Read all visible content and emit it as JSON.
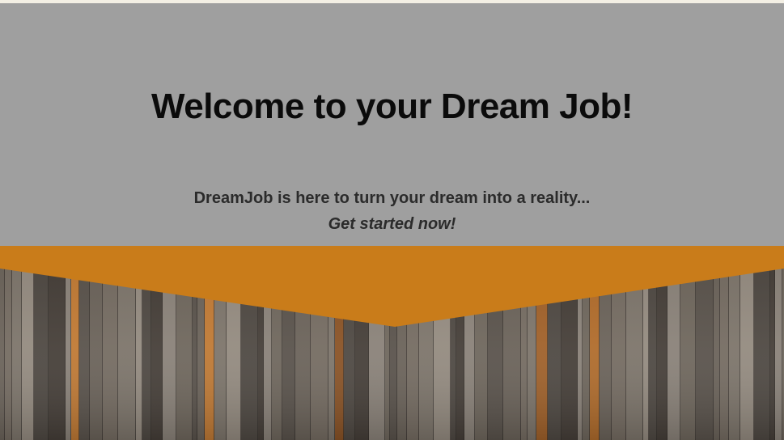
{
  "hero": {
    "title": "Welcome to your Dream Job!",
    "subtitle": "DreamJob is here to turn your dream into a reality...",
    "cta": "Get started now!"
  },
  "colors": {
    "page_background": "#f3efe4",
    "hero_background": "#9f9f9f",
    "chevron_accent": "#c97c1a",
    "wood_base": "#5e574f"
  },
  "background_image": "weathered-wood-fence"
}
